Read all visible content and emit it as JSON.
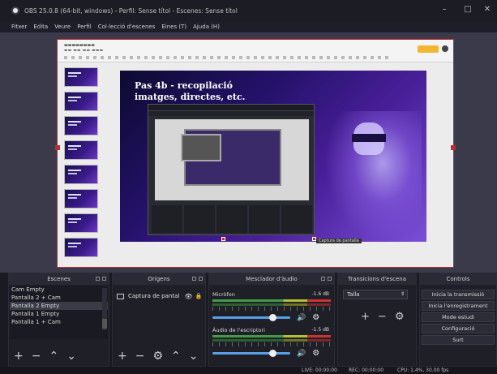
{
  "window": {
    "title": "OBS 25.0.8 (64-bit, windows) - Perfil: Sense títol - Escenes: Sense títol",
    "minimize": "–",
    "maximize": "□",
    "close": "✕"
  },
  "menu": [
    "Fitxer",
    "Edita",
    "Veure",
    "Perfil",
    "Col·lecció d'escenes",
    "Eines (T)",
    "Ajuda (H)"
  ],
  "preview": {
    "slide_title": "Pas 4b - recopilació imatges, directes, etc.",
    "source_tag": "Captura de pantalla"
  },
  "docks": {
    "scenes": {
      "header": "Escenes",
      "items": [
        "Cam Empty",
        "Pantalla 2 + Cam",
        "Pantalla 2 Empty",
        "Pantalla 1 Empty",
        "Pantalla 1 + Cam"
      ],
      "selected_index": 2
    },
    "sources": {
      "header": "Orígens",
      "items": [
        "Captura de pantal"
      ]
    },
    "mixer": {
      "header": "Mesclador d'àudio",
      "channels": [
        {
          "name": "Micròfon",
          "db": "-1.6 dB",
          "level": 0.78
        },
        {
          "name": "Àudio de l'escriptori",
          "db": "-1.5 dB",
          "level": 0.78
        }
      ]
    },
    "transitions": {
      "header": "Transicions d'escena",
      "selected": "Talla"
    },
    "controls": {
      "header": "Controls",
      "buttons": [
        "Inicia la transmissió",
        "Inicia l'enregistrament",
        "Mode estudi",
        "Configuració",
        "Surt"
      ]
    }
  },
  "status": {
    "live": "LIVE: 00:00:00",
    "rec": "REC: 00:00:00",
    "cpu": "CPU: 1.4%, 30.00 fps"
  }
}
